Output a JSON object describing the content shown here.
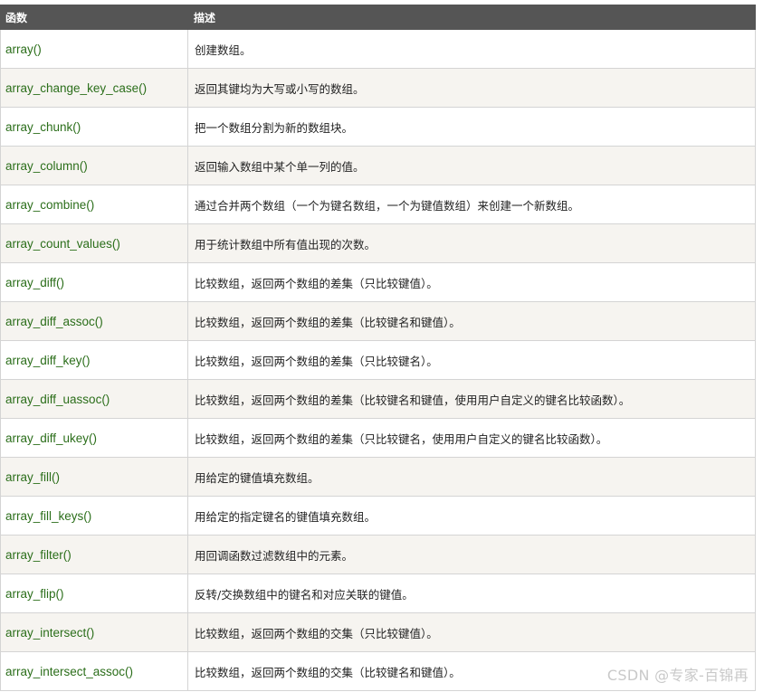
{
  "table": {
    "headers": {
      "function": "函数",
      "description": "描述"
    },
    "rows": [
      {
        "name": "array()",
        "desc": "创建数组。"
      },
      {
        "name": "array_change_key_case()",
        "desc": "返回其键均为大写或小写的数组。"
      },
      {
        "name": "array_chunk()",
        "desc": "把一个数组分割为新的数组块。"
      },
      {
        "name": "array_column()",
        "desc": "返回输入数组中某个单一列的值。"
      },
      {
        "name": "array_combine()",
        "desc": "通过合并两个数组（一个为键名数组，一个为键值数组）来创建一个新数组。"
      },
      {
        "name": "array_count_values()",
        "desc": "用于统计数组中所有值出现的次数。"
      },
      {
        "name": "array_diff()",
        "desc": "比较数组，返回两个数组的差集（只比较键值）。"
      },
      {
        "name": "array_diff_assoc()",
        "desc": "比较数组，返回两个数组的差集（比较键名和键值）。"
      },
      {
        "name": "array_diff_key()",
        "desc": "比较数组，返回两个数组的差集（只比较键名）。"
      },
      {
        "name": "array_diff_uassoc()",
        "desc": "比较数组，返回两个数组的差集（比较键名和键值，使用用户自定义的键名比较函数）。"
      },
      {
        "name": "array_diff_ukey()",
        "desc": "比较数组，返回两个数组的差集（只比较键名，使用用户自定义的键名比较函数）。"
      },
      {
        "name": "array_fill()",
        "desc": "用给定的键值填充数组。"
      },
      {
        "name": "array_fill_keys()",
        "desc": "用给定的指定键名的键值填充数组。"
      },
      {
        "name": "array_filter()",
        "desc": "用回调函数过滤数组中的元素。"
      },
      {
        "name": "array_flip()",
        "desc": "反转/交换数组中的键名和对应关联的键值。"
      },
      {
        "name": "array_intersect()",
        "desc": "比较数组，返回两个数组的交集（只比较键值）。"
      },
      {
        "name": "array_intersect_assoc()",
        "desc": "比较数组，返回两个数组的交集（比较键名和键值）。"
      }
    ]
  },
  "watermark": "CSDN @专家-百锦再",
  "colors": {
    "header_bg": "#555555",
    "header_text": "#ffffff",
    "function_text": "#2b6e1a",
    "row_alt_bg": "#f6f4f0",
    "border": "#d4d4d4"
  }
}
